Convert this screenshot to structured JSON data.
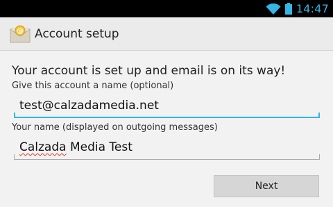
{
  "status_bar": {
    "time": "14:47",
    "icons": [
      "wifi-icon",
      "battery-icon"
    ],
    "clock_color": "#33b5e5"
  },
  "action_bar": {
    "title": "Account setup",
    "icon": "email-app-icon"
  },
  "content": {
    "headline": "Your account is set up and email is on its way!",
    "account_name_label": "Give this account a name (optional)",
    "account_name_value": "test@calzadamedia.net",
    "user_name_label": "Your name (displayed on outgoing messages)",
    "user_name_value_first": "Calzada",
    "user_name_value_rest": " Media Test"
  },
  "buttons": {
    "next_label": "Next"
  },
  "colors": {
    "accent": "#33b5e5",
    "spellcheck": "#d9352c",
    "background": "#f2f2f2"
  }
}
